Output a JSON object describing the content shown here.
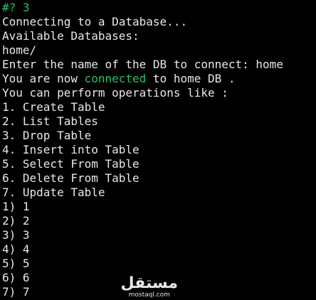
{
  "terminal": {
    "prompt_symbol": "#?",
    "prompt_input": "3",
    "lines": [
      "Connecting to a Database...",
      "Available Databases:",
      "home/",
      "Enter the name of the DB to connect: home"
    ],
    "connected_line": {
      "prefix": "You are now ",
      "highlight": "connected",
      "suffix": " to home DB ."
    },
    "operations_header": "You can perform operations like :",
    "operations": [
      "1. Create Table",
      "2. List Tables",
      "3. Drop Table",
      "4. Insert into Table",
      "5. Select From Table",
      "6. Delete From Table",
      "7. Update Table"
    ],
    "menu_options": [
      "1) 1",
      "2) 2",
      "3) 3",
      "4) 4",
      "5) 5",
      "6) 6",
      "7) 7"
    ]
  },
  "watermark": {
    "logo_text": "مستقل",
    "url": "mostaql.com"
  },
  "colors": {
    "background": "#000000",
    "text": "#e8e8e8",
    "accent_green": "#25c26a"
  }
}
